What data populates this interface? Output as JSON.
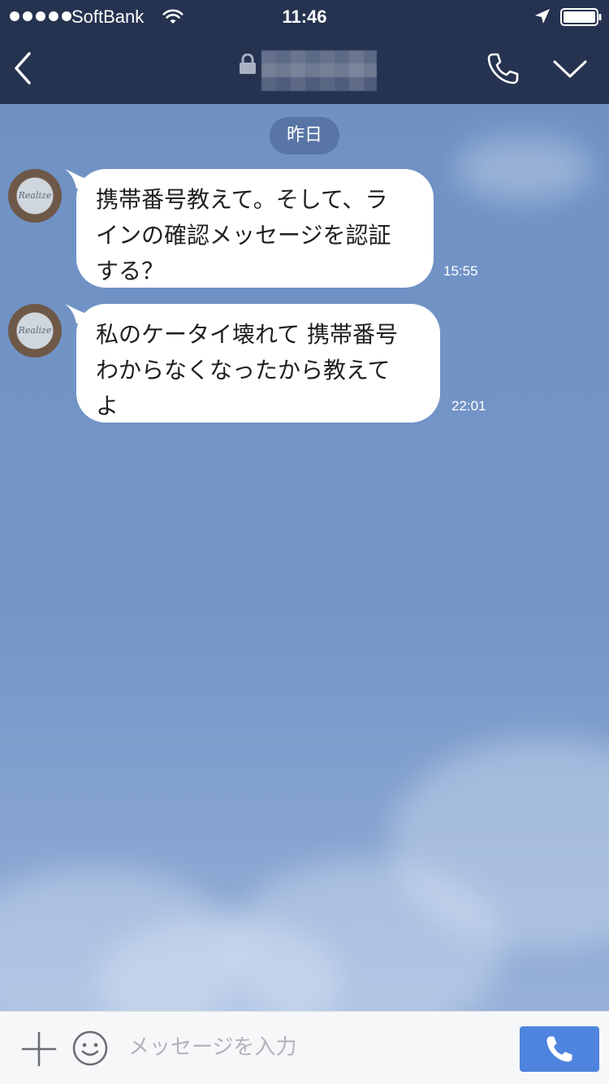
{
  "status_bar": {
    "carrier": "SoftBank",
    "time": "11:46"
  },
  "nav_bar": {
    "chat_title": ""
  },
  "chat": {
    "date_separator": "昨日",
    "messages": [
      {
        "lines": [
          "携帯番号教えて。そして、ラ",
          "インの確認メッセージを認証",
          "する？"
        ],
        "time": "15:55"
      },
      {
        "lines": [
          "私のケータイ壊れて 携帯番号",
          "わからなくなったから教えて",
          "よ"
        ],
        "time": "22:01"
      }
    ]
  },
  "input_bar": {
    "placeholder": "メッセージを入力"
  },
  "colors": {
    "header_bg": "#263350",
    "chat_bg": "#7193c6",
    "bubble_bg": "#ffffff",
    "call_button_bg": "#4f84de"
  },
  "icons": [
    "signal-dots-icon",
    "wifi-icon",
    "location-arrow-icon",
    "battery-icon",
    "back-chevron-icon",
    "lock-icon",
    "phone-icon",
    "chevron-down-icon",
    "plus-icon",
    "emoji-icon",
    "phone-call-icon"
  ]
}
